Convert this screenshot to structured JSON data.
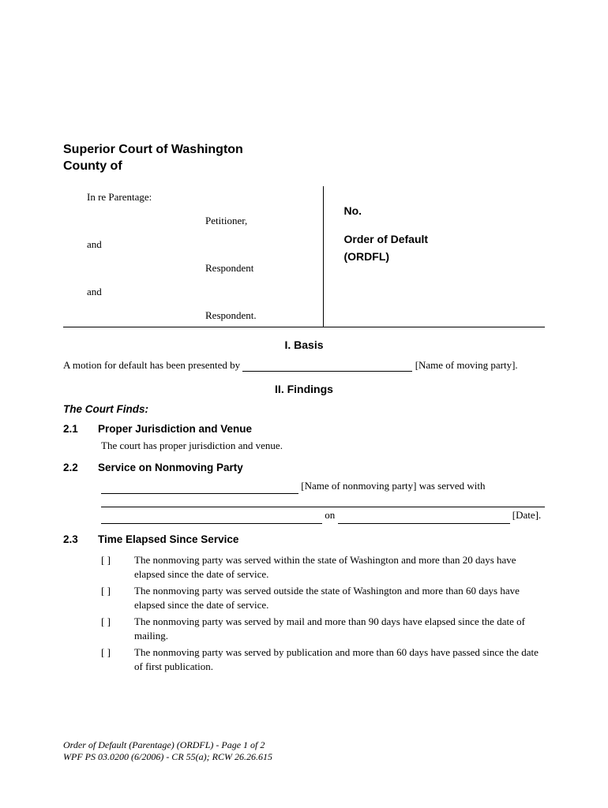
{
  "header": {
    "court_line1": "Superior Court of Washington",
    "court_line2": "County of"
  },
  "caption": {
    "in_re": "In re Parentage:",
    "petitioner_label": "Petitioner,",
    "and": "and",
    "respondent_label": "Respondent",
    "respondent_final": "Respondent.",
    "no_label": "No.",
    "doc_title_1": "Order of Default",
    "doc_title_2": "(ORDFL)"
  },
  "sections": {
    "basis": {
      "heading": "I.  Basis",
      "text_before": "A motion for default has been presented by ",
      "text_after": " [Name of moving party]."
    },
    "findings": {
      "heading": "II.  Findings",
      "court_finds": "The Court Finds:",
      "s21": {
        "num": "2.1",
        "title": "Proper Jurisdiction and Venue",
        "body": "The court has proper jurisdiction and venue."
      },
      "s22": {
        "num": "2.2",
        "title": "Service on Nonmoving Party",
        "line1_after": " [Name of nonmoving party] was served with",
        "on_word": " on ",
        "date_after": " [Date]."
      },
      "s23": {
        "num": "2.3",
        "title": "Time Elapsed Since Service",
        "opts": [
          "The nonmoving party was served within the state of Washington and more than 20 days have elapsed since the date of service.",
          "The nonmoving party was served outside the state of Washington and more than 60 days have elapsed since the date of service.",
          "The nonmoving party was served by mail and more than 90 days have elapsed since the date of mailing.",
          "The nonmoving party was served by publication and more than 60 days have passed since the date of first publication."
        ],
        "checkbox": "[  ]"
      }
    }
  },
  "footer": {
    "line1": "Order of Default (Parentage) (ORDFL) - Page 1 of 2",
    "line2": "WPF PS 03.0200 (6/2006) - CR 55(a); RCW 26.26.615"
  }
}
